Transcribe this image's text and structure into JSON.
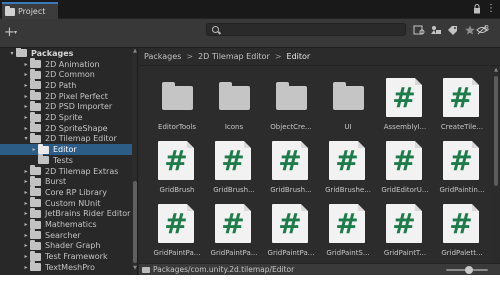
{
  "window": {
    "tab_title": "Project",
    "menu_glyph": "⋮"
  },
  "toolbar": {
    "plus_label": "+",
    "plus_caret": "▾",
    "search_placeholder": "",
    "hidden_count": "8"
  },
  "tree": {
    "items": [
      {
        "label": "Packages",
        "arrow": "▾",
        "root": true
      },
      {
        "label": "2D Animation",
        "arrow": "▸"
      },
      {
        "label": "2D Common",
        "arrow": "▸"
      },
      {
        "label": "2D Path",
        "arrow": "▸"
      },
      {
        "label": "2D Pixel Perfect",
        "arrow": "▸"
      },
      {
        "label": "2D PSD Importer",
        "arrow": "▸"
      },
      {
        "label": "2D Sprite",
        "arrow": "▸"
      },
      {
        "label": "2D SpriteShape",
        "arrow": "▸"
      },
      {
        "label": "2D Tilemap Editor",
        "arrow": "▾"
      },
      {
        "label": "Editor",
        "arrow": "▸",
        "selected": true
      },
      {
        "label": "Tests",
        "arrow": ""
      },
      {
        "label": "2D Tilemap Extras",
        "arrow": "▸"
      },
      {
        "label": "Burst",
        "arrow": "▸"
      },
      {
        "label": "Core RP Library",
        "arrow": "▸"
      },
      {
        "label": "Custom NUnit",
        "arrow": "▸"
      },
      {
        "label": "JetBrains Rider Editor",
        "arrow": "▸"
      },
      {
        "label": "Mathematics",
        "arrow": "▸"
      },
      {
        "label": "Searcher",
        "arrow": "▸"
      },
      {
        "label": "Shader Graph",
        "arrow": "▸"
      },
      {
        "label": "Test Framework",
        "arrow": "▸"
      },
      {
        "label": "TextMeshPro",
        "arrow": "▸"
      }
    ],
    "scroll_up": "▲",
    "scroll_down": "▼"
  },
  "breadcrumb": {
    "items": [
      "Packages",
      "2D Tilemap Editor",
      "Editor"
    ],
    "separator": ">"
  },
  "assets": {
    "items": [
      {
        "label": "EditorTools",
        "kind": "folder"
      },
      {
        "label": "Icons",
        "kind": "folder"
      },
      {
        "label": "ObjectCre...",
        "kind": "folder"
      },
      {
        "label": "UI",
        "kind": "folder"
      },
      {
        "label": "AssemblyI...",
        "kind": "script"
      },
      {
        "label": "CreateTile...",
        "kind": "script"
      },
      {
        "label": "GridBrush",
        "kind": "script"
      },
      {
        "label": "GridBrush...",
        "kind": "script"
      },
      {
        "label": "GridBrush...",
        "kind": "script"
      },
      {
        "label": "GridBrushe...",
        "kind": "script"
      },
      {
        "label": "GridEditorU...",
        "kind": "script"
      },
      {
        "label": "GridPaintin...",
        "kind": "script"
      },
      {
        "label": "GridPaintPa...",
        "kind": "script"
      },
      {
        "label": "GridPaintPa...",
        "kind": "script"
      },
      {
        "label": "GridPaintPa...",
        "kind": "script"
      },
      {
        "label": "GridPaintS...",
        "kind": "script"
      },
      {
        "label": "GridPaintT...",
        "kind": "script"
      },
      {
        "label": "GridPalett...",
        "kind": "script"
      }
    ],
    "script_glyph": "#",
    "scroll_up": "▲"
  },
  "status": {
    "path": "Packages/com.unity.2d.tilemap/Editor",
    "zoom_level": 0.55
  },
  "colors": {
    "accent": "#3a79bb",
    "selection": "#2c5d87",
    "script_hash": "#1e7b4a"
  }
}
